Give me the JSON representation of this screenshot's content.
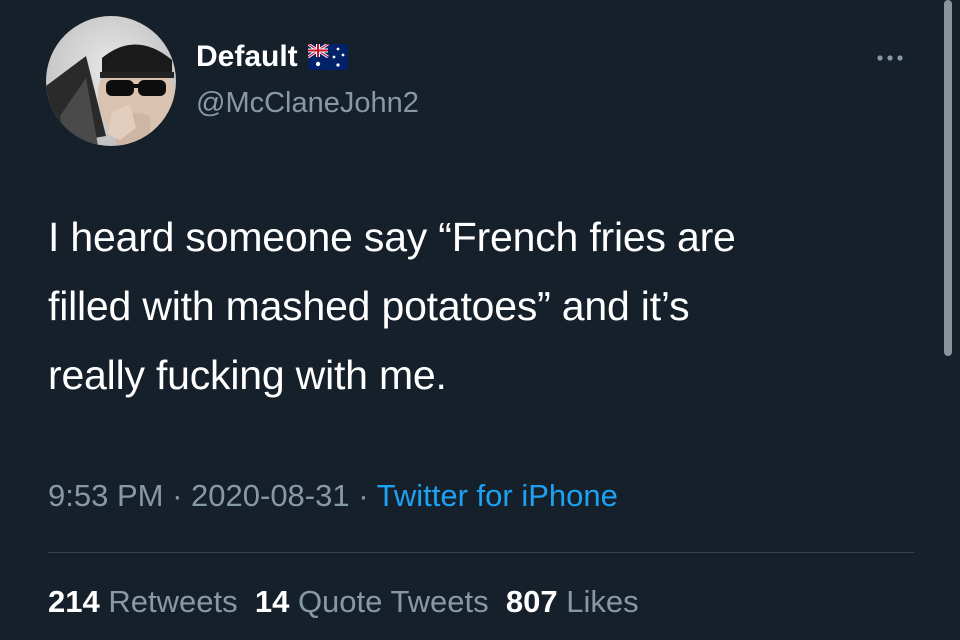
{
  "user": {
    "display_name": "Default",
    "handle": "@McClaneJohn2",
    "flag_icon": "australia-flag-icon",
    "avatar_icon": "avatar-photo"
  },
  "tweet": {
    "text_lines": [
      "I heard someone say “French fries are",
      "filled with mashed potatoes” and it’s",
      "really fucking with me."
    ]
  },
  "meta": {
    "time": "9:53 PM",
    "separator": "·",
    "date": "2020-08-31",
    "source": "Twitter for iPhone"
  },
  "stats": {
    "retweets_count": "214",
    "retweets_label": "Retweets",
    "quote_count": "14",
    "quote_label": "Quote Tweets",
    "likes_count": "807",
    "likes_label": "Likes"
  },
  "icons": {
    "more": "more-options-icon"
  },
  "colors": {
    "background": "#15202b",
    "primary_text": "#ffffff",
    "secondary_text": "#8899a6",
    "link": "#1da1f2",
    "divider": "#38444d"
  }
}
